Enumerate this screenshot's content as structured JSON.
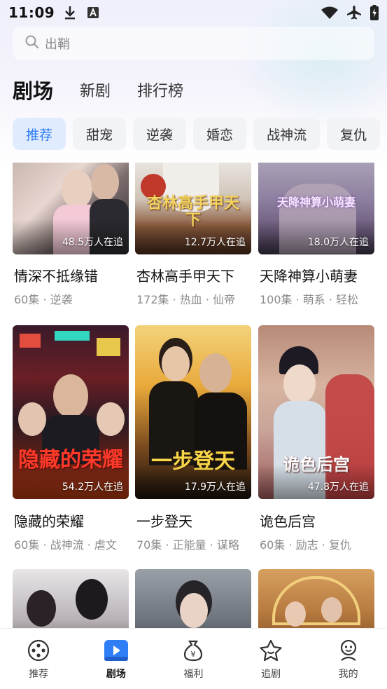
{
  "status_bar": {
    "time": "11:09"
  },
  "search": {
    "placeholder": "出鞘"
  },
  "main_tabs": [
    "剧场",
    "新剧",
    "排行榜"
  ],
  "categories": [
    "推荐",
    "甜宠",
    "逆袭",
    "婚恋",
    "战神流",
    "复仇"
  ],
  "dramas": [
    {
      "title": "情深不抵缘错",
      "meta": "60集 · 逆袭",
      "followers": "48.5万人在追",
      "poster_text": ""
    },
    {
      "title": "杏林高手甲天下",
      "meta": "172集 · 热血 · 仙帝",
      "followers": "12.7万人在追",
      "poster_text": "杏林高手甲天下"
    },
    {
      "title": "天降神算小萌妻",
      "meta": "100集 · 萌系 · 轻松",
      "followers": "18.0万人在追",
      "poster_text": "天降神算小萌妻"
    },
    {
      "title": "隐藏的荣耀",
      "meta": "60集 · 战神流 · 虐文",
      "followers": "54.2万人在追",
      "poster_text": "隐藏的荣耀"
    },
    {
      "title": "一步登天",
      "meta": "70集 · 正能量 · 谋略",
      "followers": "17.9万人在追",
      "poster_text": "一步登天"
    },
    {
      "title": "诡色后宫",
      "meta": "60集 · 励志 · 复仇",
      "followers": "47.8万人在追",
      "poster_text": "诡色后宫"
    }
  ],
  "bottom_tabs": [
    "推荐",
    "剧场",
    "福利",
    "追剧",
    "我的"
  ],
  "colors": {
    "accent": "#2f7ef6",
    "chip_active_bg": "#e0ecfd"
  }
}
